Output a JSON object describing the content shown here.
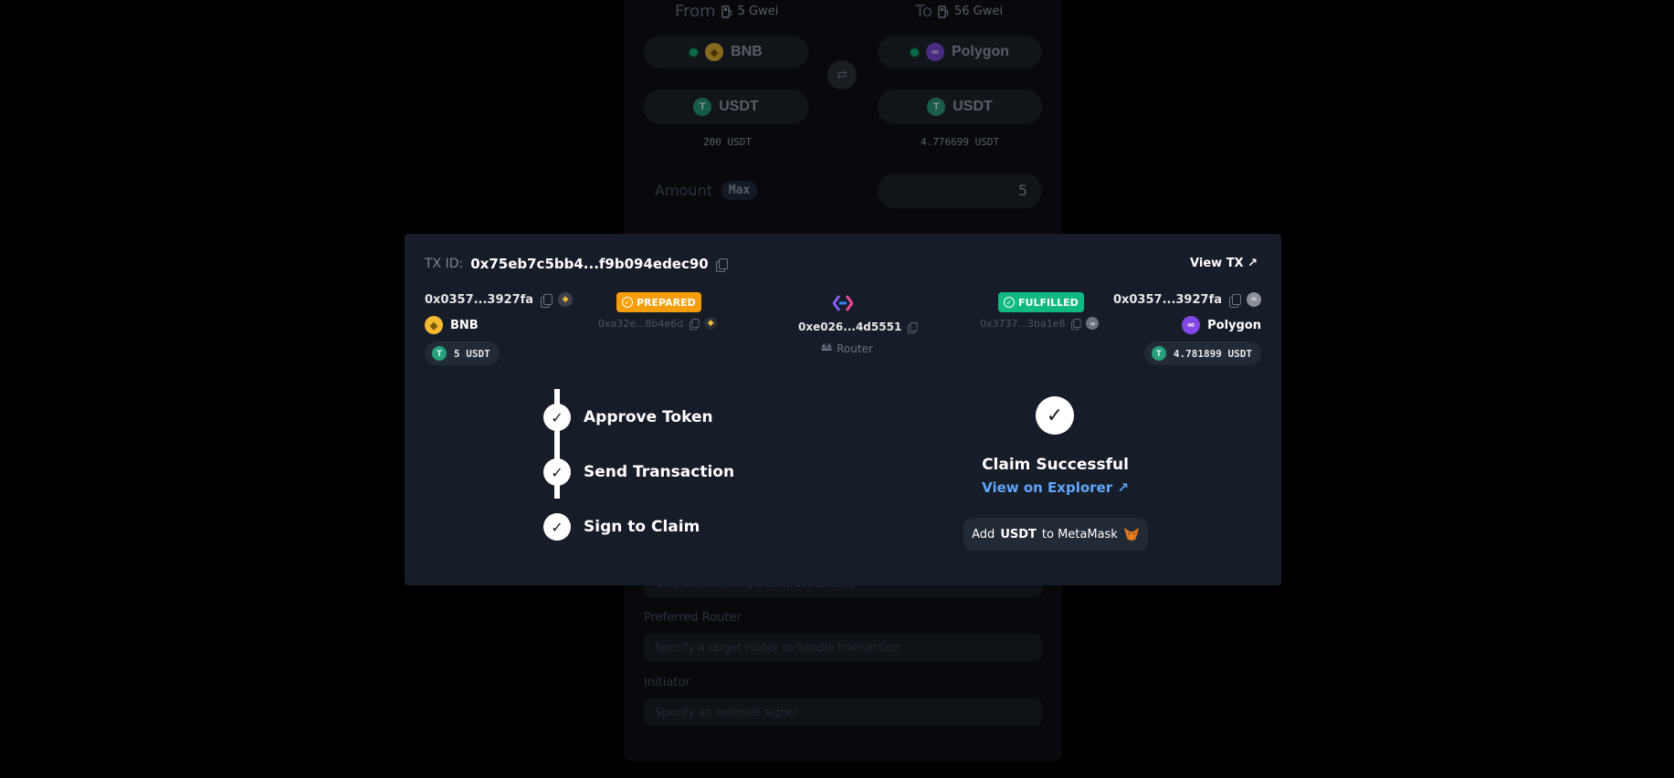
{
  "form": {
    "from_label": "From",
    "from_gas": "5 Gwei",
    "to_label": "To",
    "to_gas": "56 Gwei",
    "from_chain": "BNB",
    "to_chain": "Polygon",
    "from_token": "USDT",
    "to_token": "USDT",
    "from_balance": "200 USDT",
    "to_balance": "4.776699 USDT",
    "amount_label": "Amount",
    "max_label": "Max",
    "amount_value": "5",
    "hidden_field_placeholder": "Only when calling a contract directly",
    "router_label": "Preferred Router",
    "router_placeholder": "Specify a target router to handle transaction",
    "initiator_label": "Initiator",
    "initiator_placeholder": "Specify an external signer"
  },
  "modal": {
    "txid_label": "TX ID:",
    "txid_value": "0x75eb7c5bb4...f9b094edec90",
    "view_tx": "View TX ↗",
    "sender": {
      "address": "0x0357...3927fa",
      "chain": "BNB",
      "amount": "5 USDT"
    },
    "prepared_badge": "PREPARED",
    "prepared_tx": "0xa32e...8b4e6d",
    "router": {
      "address": "0xe026...4d5551",
      "label": "Router"
    },
    "fulfilled_badge": "FULFILLED",
    "fulfilled_tx": "0x3737...3ba1e8",
    "receiver": {
      "address": "0x0357...3927fa",
      "chain": "Polygon",
      "amount": "4.781899 USDT"
    },
    "steps": [
      "Approve Token",
      "Send Transaction",
      "Sign to Claim"
    ],
    "claim_title": "Claim Successful",
    "explorer_link": "View on Explorer ↗",
    "metamask_prefix": "Add",
    "metamask_token": "USDT",
    "metamask_suffix": "to MetaMask"
  },
  "colors": {
    "prepared": "#f59e0b",
    "fulfilled": "#10b981",
    "link": "#60a5fa",
    "usdt": "#26a17b",
    "bnb": "#f3ba2f",
    "polygon": "#8247e5"
  },
  "icons": [
    "gas-pump-icon",
    "bnb-icon",
    "polygon-icon",
    "usdt-icon",
    "swap-icon",
    "copy-icon",
    "external-link-icon",
    "check-icon",
    "connext-logo-icon",
    "router-icon",
    "metamask-fox-icon"
  ]
}
